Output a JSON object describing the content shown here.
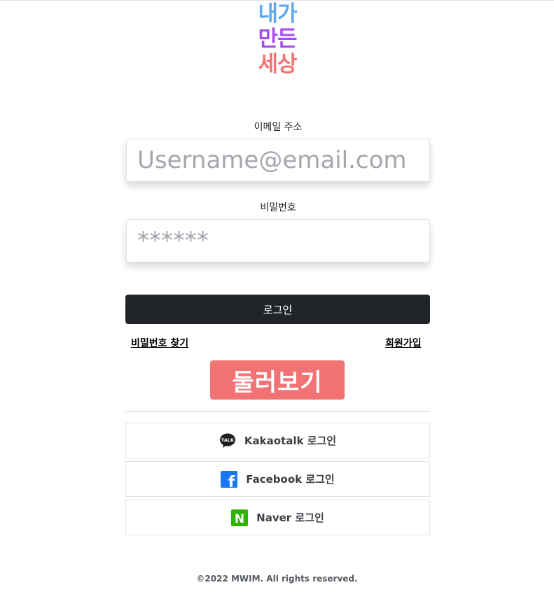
{
  "logo": {
    "line1": "내가",
    "line2": "만든",
    "line3": "세상"
  },
  "form": {
    "email_label": "이메일 주소",
    "email_placeholder": "Username@email.com",
    "password_label": "비밀번호",
    "password_placeholder": "******",
    "login_button": "로그인"
  },
  "links": {
    "find_password": "비밀번호 찾기",
    "signup": "회원가입"
  },
  "browse_button": "둘러보기",
  "social": {
    "kakao": {
      "label": "Kakaotalk 로그인",
      "icon_text": "TALK",
      "icon": "kakaotalk-icon"
    },
    "facebook": {
      "label": "Facebook 로그인",
      "icon_text": "f",
      "icon": "facebook-icon"
    },
    "naver": {
      "label": "Naver 로그인",
      "icon_text": "N",
      "icon": "naver-icon"
    }
  },
  "footer": "©2022 MWIM. All rights reserved.",
  "colors": {
    "logo_blue": "#5ea9f2",
    "logo_purple": "#a64df0",
    "logo_red": "#f27373",
    "login_button": "#212529",
    "browse_button": "#f27373",
    "facebook": "#1877f2",
    "naver": "#2db400"
  }
}
